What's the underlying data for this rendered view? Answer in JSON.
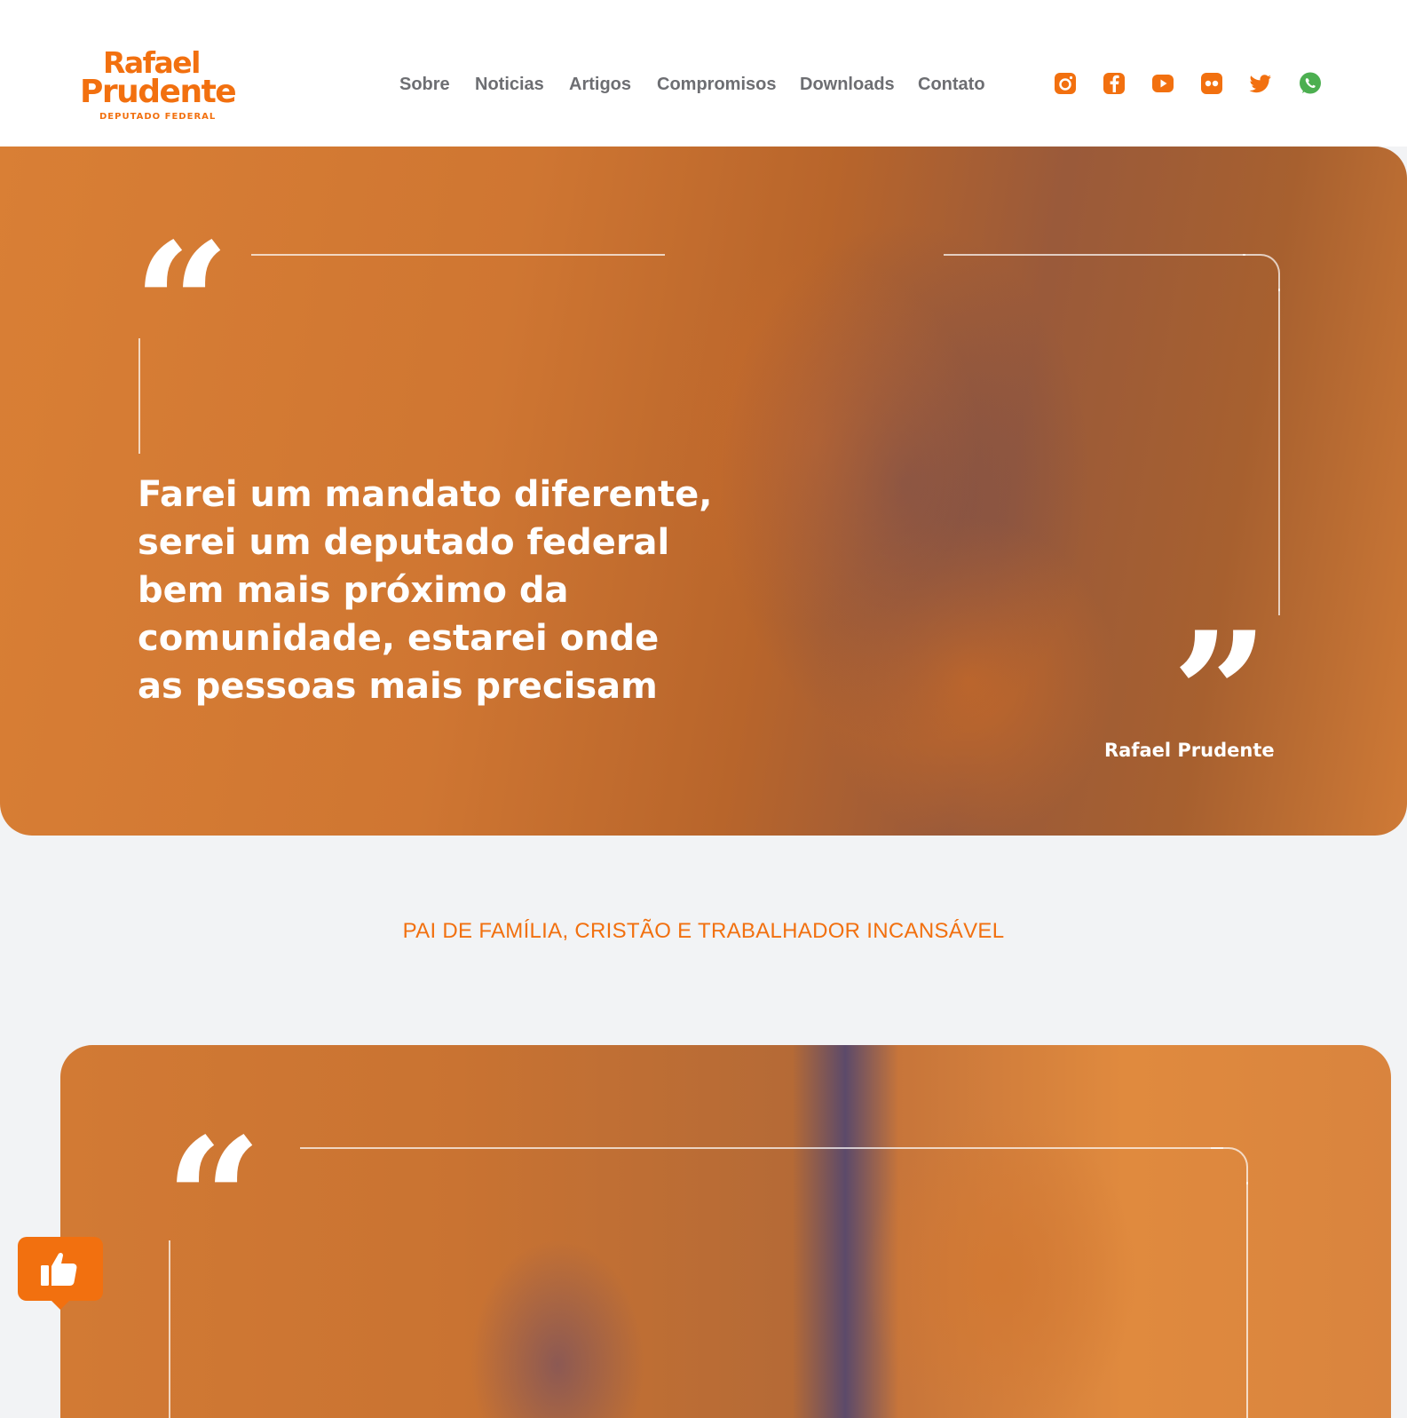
{
  "brand": {
    "name_line1": "Rafael",
    "name_line2": "Prudente",
    "subtitle": "DEPUTADO FEDERAL",
    "accent_color": "#f2700f"
  },
  "nav": {
    "items": [
      "Sobre",
      "Noticias",
      "Artigos",
      "Compromisos",
      "Downloads",
      "Contato"
    ]
  },
  "social": [
    {
      "icon": "instagram-icon",
      "color": "#f2700f"
    },
    {
      "icon": "facebook-icon",
      "color": "#f2700f"
    },
    {
      "icon": "youtube-icon",
      "color": "#f2700f"
    },
    {
      "icon": "flickr-icon",
      "color": "#f2700f"
    },
    {
      "icon": "twitter-icon",
      "color": "#f2700f"
    },
    {
      "icon": "whatsapp-icon",
      "color": "#4caf50"
    }
  ],
  "hero": {
    "quote": "Farei um mandato diferente,\nserei um deputado federal\nbem mais próximo da\ncomunidade, estarei onde\nas pessoas mais precisam",
    "author": "Rafael Prudente"
  },
  "tagline": "PAI DE FAMÍLIA, CRISTÃO E TRABALHADOR INCANSÁVEL",
  "floating_button": {
    "icon": "thumbs-up-icon"
  }
}
